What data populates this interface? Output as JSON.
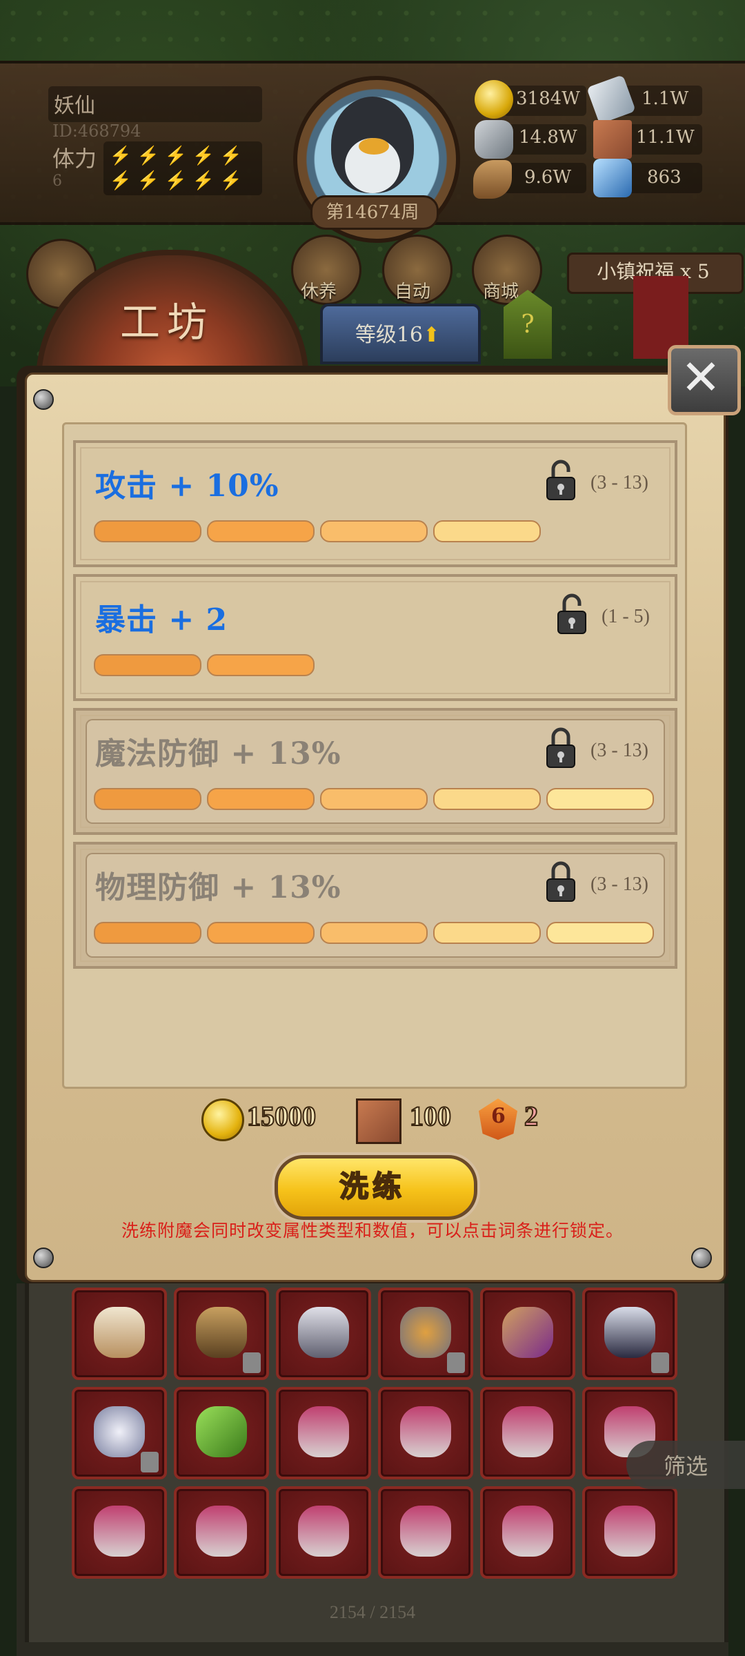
{
  "player": {
    "name": "妖仙",
    "id": "ID:468794",
    "stamina_label": "体力",
    "stamina_value": "6"
  },
  "avatar": {
    "week": "第14674周"
  },
  "resources": [
    {
      "icon": "gold-coin-icon",
      "value": "3184W"
    },
    {
      "icon": "iron-ingot-icon",
      "value": "1.1W"
    },
    {
      "icon": "ore-icon",
      "value": "14.8W"
    },
    {
      "icon": "parchment-icon",
      "value": "11.1W"
    },
    {
      "icon": "wood-log-icon",
      "value": "9.6W"
    },
    {
      "icon": "crystal-icon",
      "value": "863"
    }
  ],
  "nav": {
    "rest": "休养",
    "auto": "自动",
    "shop": "商城",
    "blessing": "小镇祝福 x 5"
  },
  "workshop": {
    "title": "工坊",
    "level": "等级16",
    "help": "?"
  },
  "stats": [
    {
      "label": "攻击 + 10%",
      "range": "(3 - 13)",
      "locked": false,
      "bars": 4,
      "color": "blue"
    },
    {
      "label": "暴击 + 2",
      "range": "(1 - 5)",
      "locked": false,
      "bars": 2,
      "color": "blue"
    },
    {
      "label": "魔法防御 + 13%",
      "range": "(3 - 13)",
      "locked": true,
      "bars": 5,
      "color": "gray"
    },
    {
      "label": "物理防御 + 13%",
      "range": "(3 - 13)",
      "locked": true,
      "bars": 5,
      "color": "gray"
    }
  ],
  "cost": {
    "gold": "15000",
    "parchment": "100",
    "gem": "2",
    "gem_symbol": "6"
  },
  "refine": {
    "button": "洗练",
    "hint": "洗练附魔会同时改变属性类型和数值，可以点击词条进行锁定。"
  },
  "inventory": {
    "filter": "筛选",
    "count": "2154 / 2154"
  },
  "colors": {
    "stat_blue": "#1a6ee0",
    "stat_gray": "#8a8175",
    "hint_red": "#d9201a",
    "refine_yellow": "#f6c21a"
  }
}
